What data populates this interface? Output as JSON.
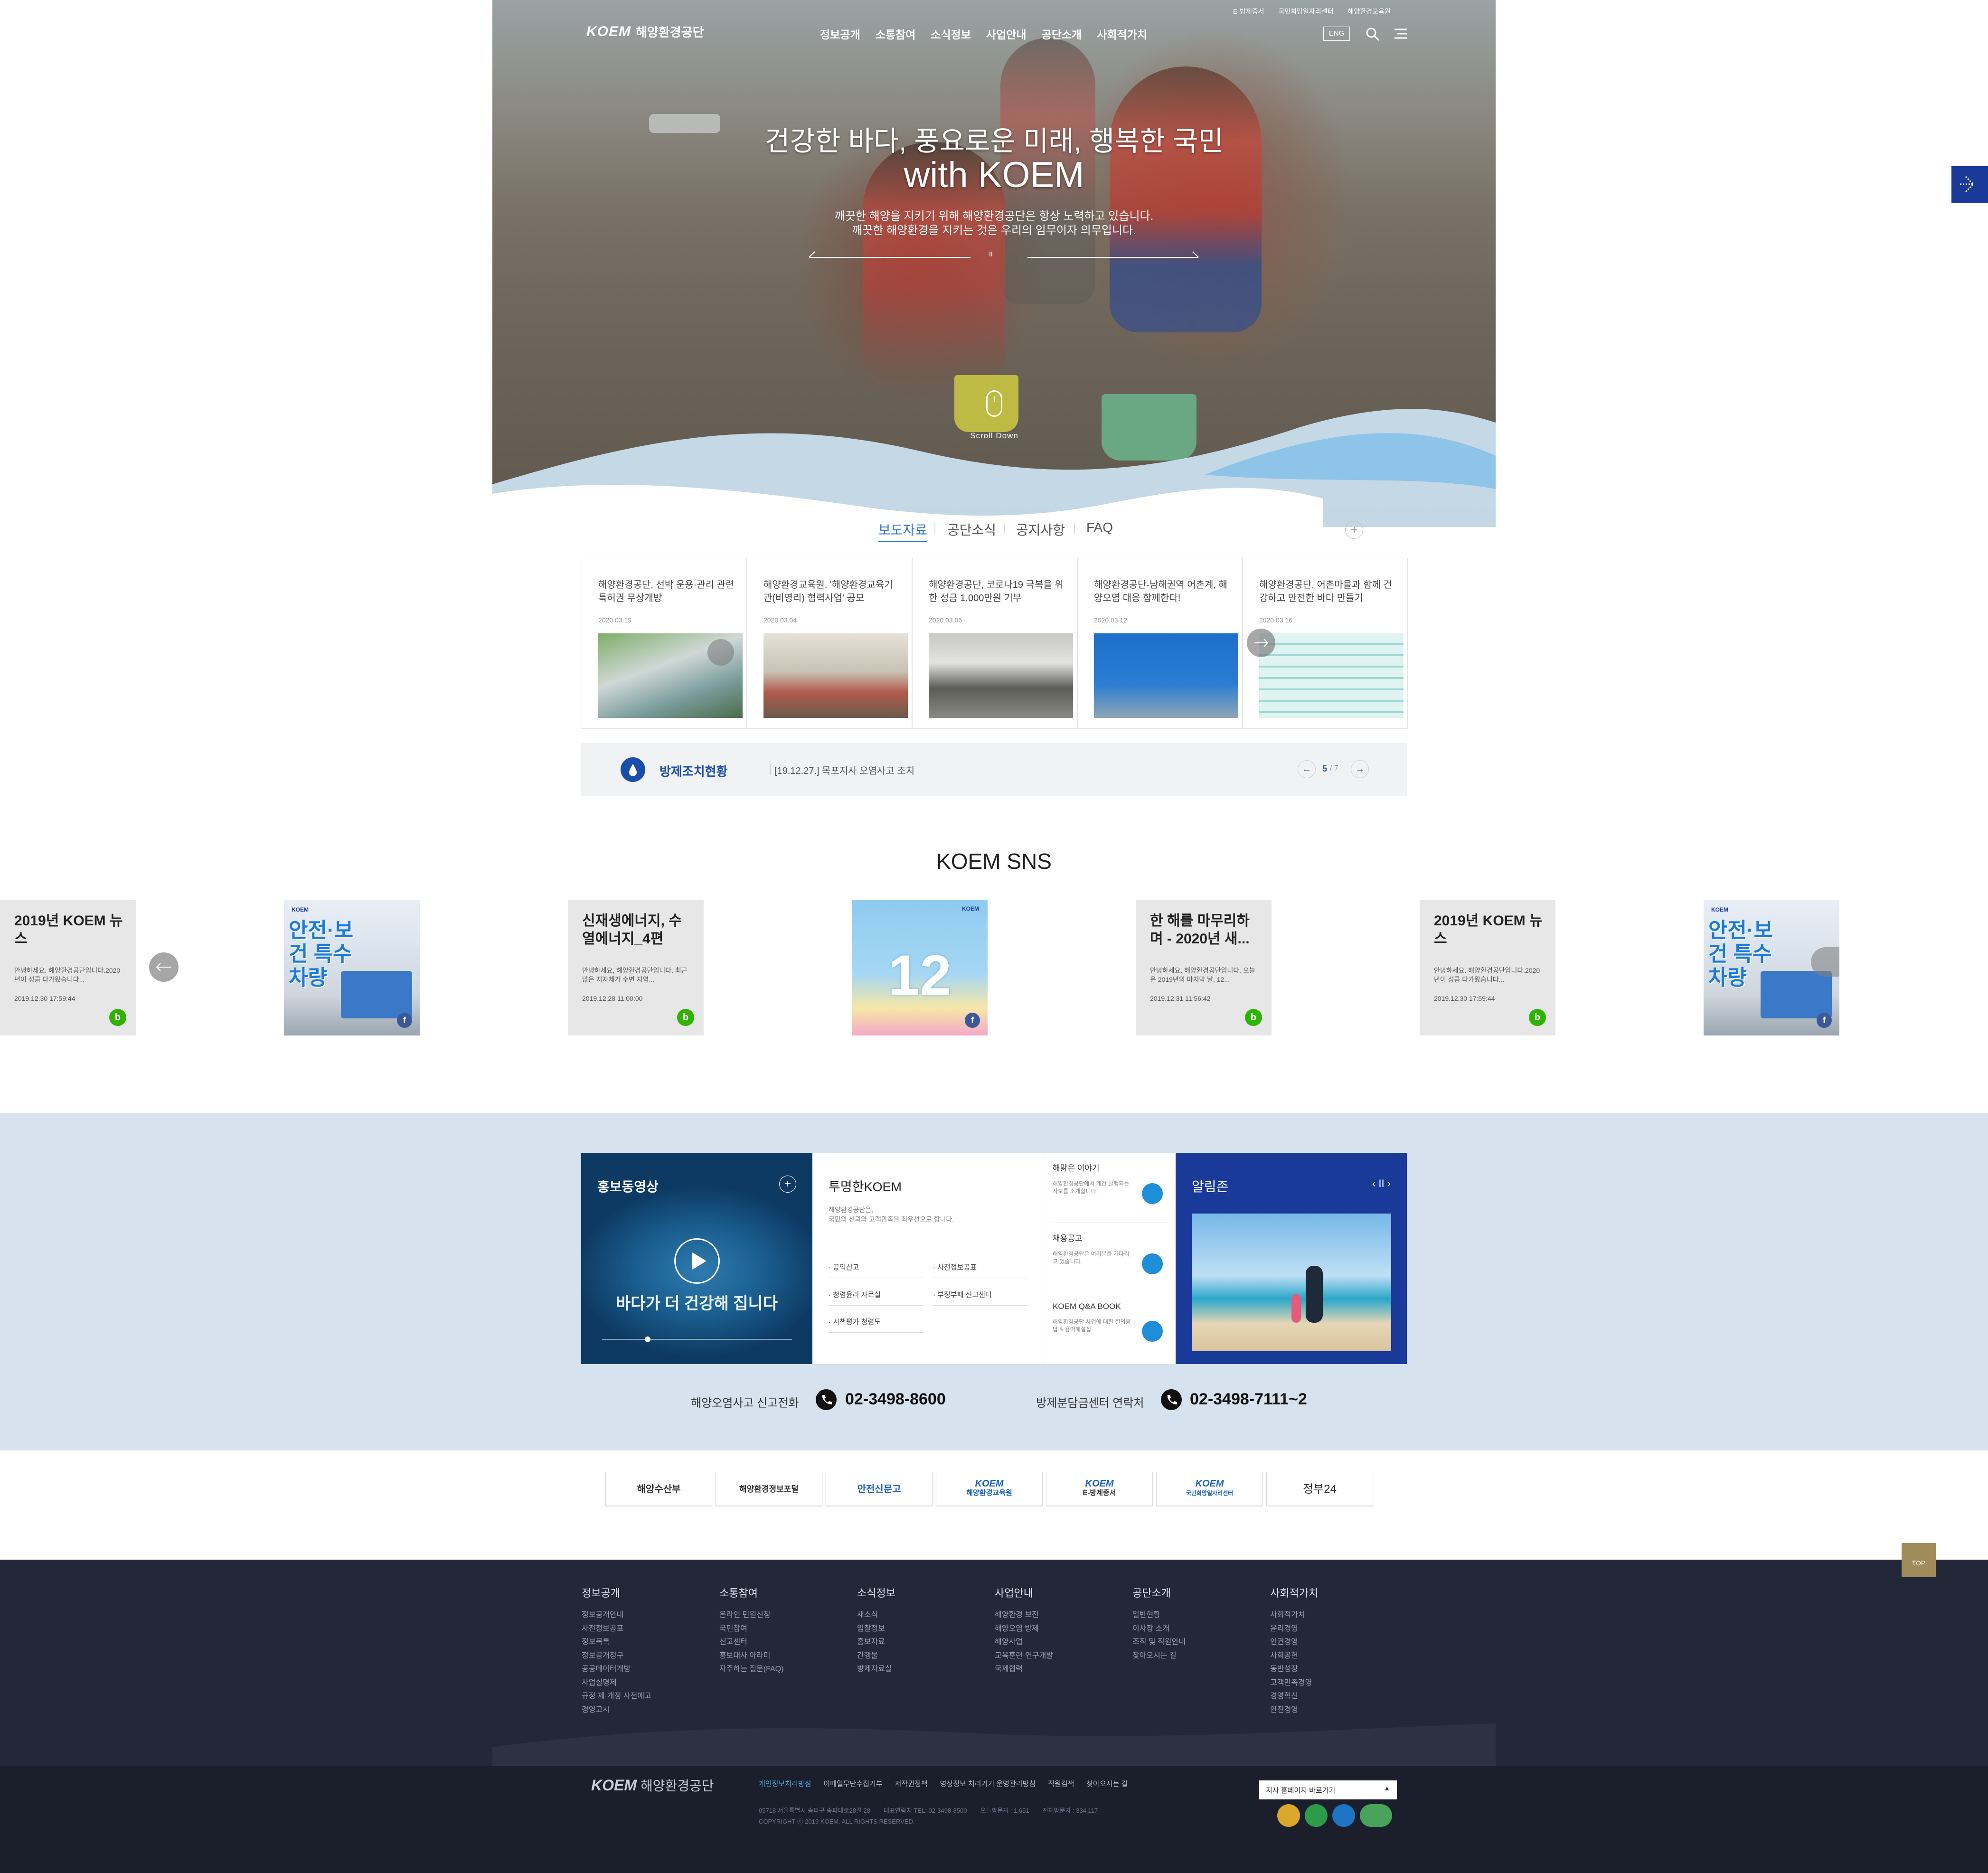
{
  "header": {
    "logo_mark": "KOEM",
    "logo_name": "해양환경공단",
    "util_links": [
      "E-방제증서",
      "국민희망일자리센터",
      "해양환경교육원"
    ],
    "nav": [
      "정보공개",
      "소통참여",
      "소식정보",
      "사업안내",
      "공단소개",
      "사회적가치"
    ],
    "lang": "ENG"
  },
  "hero": {
    "title_line1": "건강한 바다, 풍요로운 미래, 행복한 국민",
    "title_line2": "with KOEM",
    "sub_line1": "깨끗한 해양을 지키기 위해 해양환경공단은 항상 노력하고 있습니다.",
    "sub_line2": "깨끗한 해양환경을 지키는 것은 우리의 임무이자 의무입니다.",
    "pause": "II",
    "scroll_label": "Scroll Down"
  },
  "news": {
    "tabs": [
      "보도자료",
      "공단소식",
      "공지사항",
      "FAQ"
    ],
    "active_tab": 0,
    "more": "+",
    "cards": [
      {
        "title": "해양환경공단, 선박 운용·관리 관련 특허권 무상개방",
        "date": "2020.03.19"
      },
      {
        "title": "해양환경교육원, '해양환경교육기관(비영리) 협력사업' 공모",
        "date": "2020.03.04"
      },
      {
        "title": "해양환경공단, 코로나19 극복을 위한 성금 1,000만원 기부",
        "date": "2020.03.06"
      },
      {
        "title": "해양환경공단-남해권역 어촌계, 해양오염 대응 함께한다!",
        "date": "2020.03.12"
      },
      {
        "title": "해양환경공단, 어촌마을과 함께 건강하고 안전한 바다 만들기",
        "date": "2020.03.16"
      }
    ]
  },
  "response": {
    "label": "방제조치현황",
    "item": "[19.12.27.] 목포지사 오염사고 조치",
    "page_current": "5",
    "page_total": "/ 7"
  },
  "sns": {
    "title": "KOEM SNS",
    "text_cards": [
      {
        "title": "2019년 KOEM 뉴스",
        "body": "안녕하세요. 해양환경공단입니다.2020년이 성큼 다가왔습니다...",
        "date": "2019.12.30 17:59:44",
        "badge": "b"
      },
      {
        "title": "신재생에너지, 수열에너지_4편",
        "body": "안녕하세요, 해양환경공단입니다. 최근 많은 지자체가 수변 지역...",
        "date": "2019.12.28 11:00:00",
        "badge": "b"
      },
      {
        "title": "한 해를 마무리하며 - 2020년 새...",
        "body": "안녕하세요. 해양환경공단입니다. 오늘은 2019년의 마지막 날, 12...",
        "date": "2019.12.31 11:56:42",
        "badge": "b"
      },
      {
        "title": "2019년 KOEM 뉴스",
        "body": "안녕하세요. 해양환경공단입니다.2020년이 성큼 다가왔습니다...",
        "date": "2019.12.30 17:59:44",
        "badge": "b"
      }
    ],
    "image_cards": [
      {
        "headline": "안전·보건 특수차량",
        "brand": "KOEM",
        "badge": "f"
      },
      {
        "headline": "12",
        "brand": "KOEM",
        "badge": "f"
      },
      {
        "headline": "안전·보건 특수차량",
        "brand": "KOEM",
        "badge": "f"
      }
    ]
  },
  "promo": {
    "video_title": "홍보동영상",
    "video_caption": "바다가 더 건강해 집니다",
    "transparent_title": "투명한KOEM",
    "transparent_desc1": "해양환경공단은,",
    "transparent_desc2": "국민의 신뢰와 고객만족을 최우선으로 합니다.",
    "links": [
      "공익신고",
      "사전정보공표",
      "청렴윤리 자료실",
      "부정부패 신고센터",
      "시책평가 청렴도"
    ],
    "mini": [
      {
        "title": "해맑은 이야기",
        "desc": "해양환경공단에서 개간 발행되는 사보를 소개합니다."
      },
      {
        "title": "채용공고",
        "desc": "해양환경공단은 여러분을 기다리고 있습니다."
      },
      {
        "title": "KOEM Q&A BOOK",
        "desc": "해양환경공단 사업에 대한 질의응답 & 용어해설집"
      }
    ],
    "notice_title": "알림존",
    "notice_ctrl": "‹ II ›"
  },
  "hotline": {
    "label1": "해양오염사고 신고전화",
    "phone1": "02-3498-8600",
    "label2": "방제분담금센터 연락처",
    "phone2": "02-3498-7111~2"
  },
  "partners": [
    "해양수산부",
    "해양환경정보포털",
    "안전신문고",
    "해양환경교육원",
    "E-방제증서",
    "국민희망일자리센터",
    "정부24"
  ],
  "partner_sub": {
    "koem1": "KOEM",
    "koem2": "KOEM",
    "koem3": "KOEM"
  },
  "top_button": "TOP",
  "footer": {
    "columns": [
      {
        "title": "정보공개",
        "items": [
          "정보공개안내",
          "사전정보공표",
          "정보목록",
          "정보공개청구",
          "공공데이터개방",
          "사업실명제",
          "규정 제·개정 사전예고",
          "경영고시"
        ]
      },
      {
        "title": "소통참여",
        "items": [
          "온라인 민원신청",
          "국민참여",
          "신고센터",
          "홍보대사 아라미",
          "자주하는 질문(FAQ)"
        ]
      },
      {
        "title": "소식정보",
        "items": [
          "새소식",
          "입찰정보",
          "홍보자료",
          "간행물",
          "방제자료실"
        ]
      },
      {
        "title": "사업안내",
        "items": [
          "해양환경 보전",
          "해양오염 방제",
          "해양사업",
          "교육훈련·연구개발",
          "국제협력"
        ]
      },
      {
        "title": "공단소개",
        "items": [
          "일반현황",
          "이사장 소개",
          "조직 및 직원안내",
          "찾아오시는 길"
        ]
      },
      {
        "title": "사회적가치",
        "items": [
          "사회적가치",
          "윤리경영",
          "인권경영",
          "사회공헌",
          "동반성장",
          "고객만족경영",
          "경영혁신",
          "안전경영"
        ]
      }
    ],
    "logo_mark": "KOEM",
    "logo_name": "해양환경공단",
    "policy_links": [
      "개인정보처리방침",
      "이메일무단수집거부",
      "저작권정책",
      "영상정보 처리기기 운영관리방침",
      "직원검색",
      "찾아오시는 길"
    ],
    "address": "05718 서울특별시 송파구 송파대로28길 28",
    "tel": "대표연락처 TEL: 02-3498-8500",
    "visitors_today": "오늘방문자 : 1,651",
    "visitors_total": "전체방문자 : 334,117",
    "copyright": "COPYRIGHT ⓒ 2019 KOEM. ALL RIGHTS RESERVED.",
    "select_label": "지사 홈페이지 바로가기"
  },
  "colors": {
    "accent_blue": "#1a3a9a",
    "tab_blue": "#2a6fd0",
    "promo_bg": "#d6e2ee",
    "footer_bg": "#232838",
    "footer_bottom_bg": "#1b1f2c"
  }
}
